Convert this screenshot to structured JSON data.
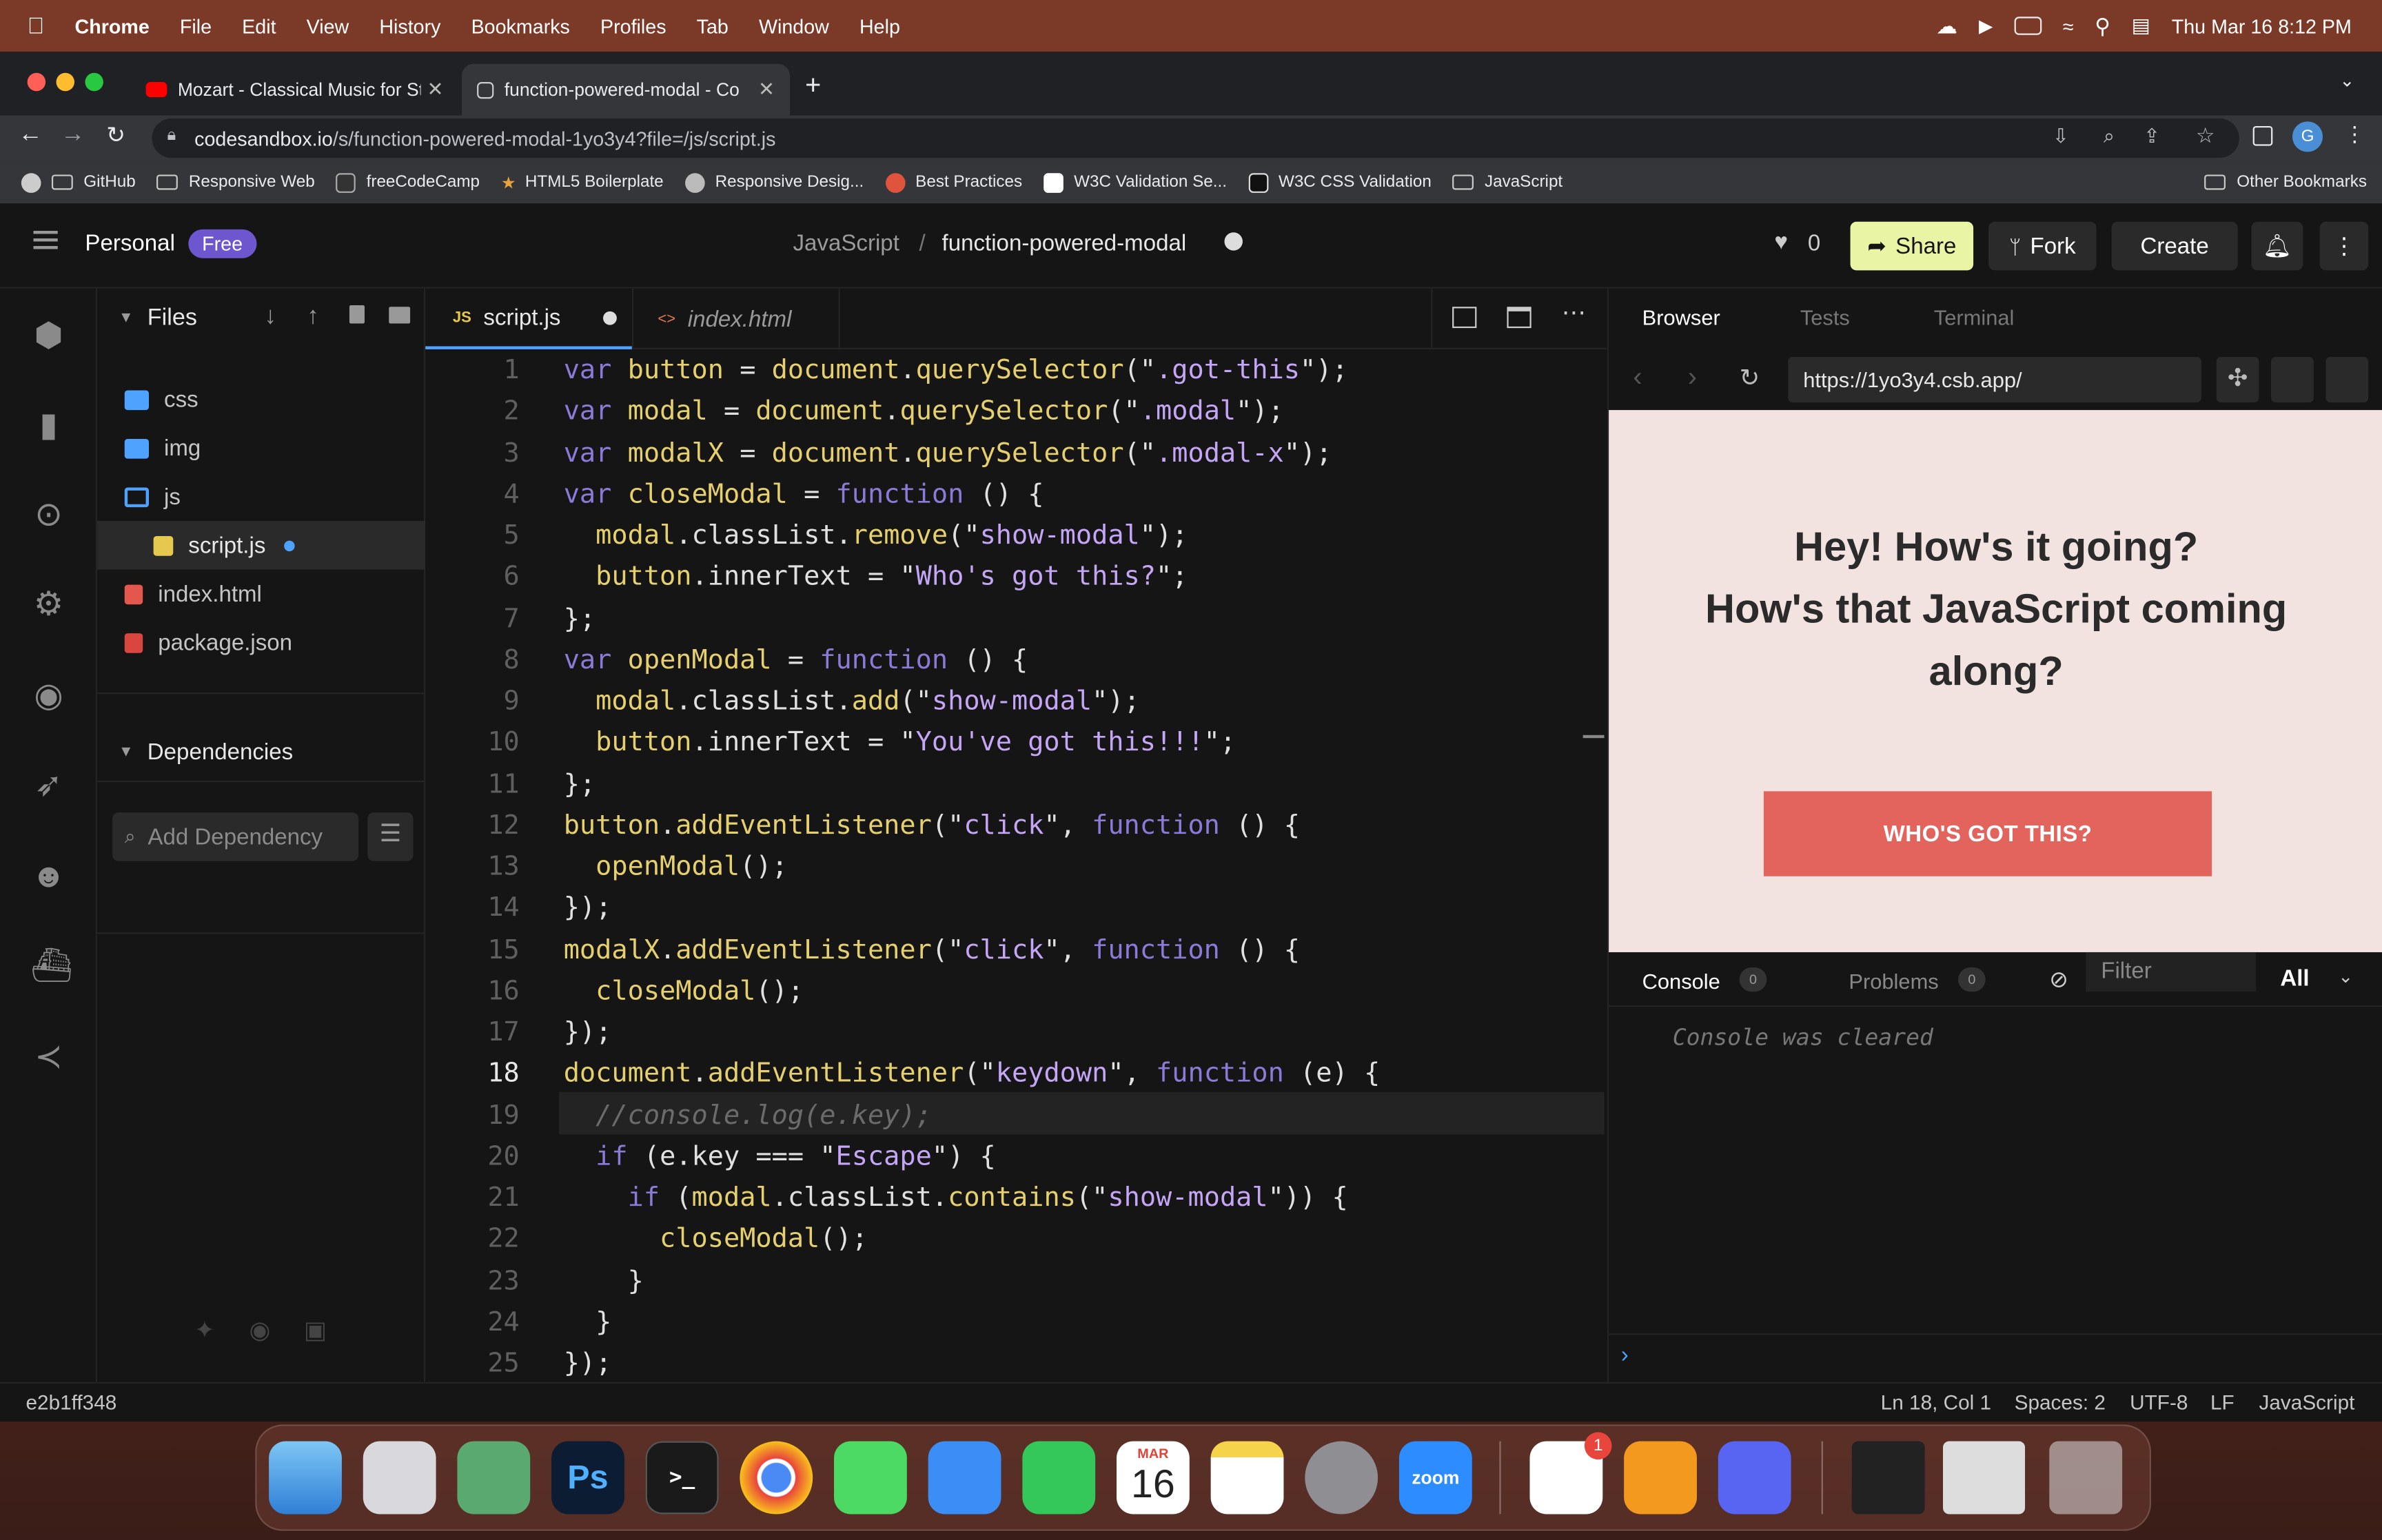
{
  "menubar": {
    "app": "Chrome",
    "items": [
      "File",
      "Edit",
      "View",
      "History",
      "Bookmarks",
      "Profiles",
      "Tab",
      "Window",
      "Help"
    ],
    "clock": "Thu Mar 16  8:12 PM"
  },
  "browser": {
    "tabs": [
      {
        "title": "Mozart - Classical Music for St",
        "active": false
      },
      {
        "title": "function-powered-modal - Co",
        "active": true
      }
    ],
    "url_host": "codesandbox.io",
    "url_path": "/s/function-powered-modal-1yo3y4?file=/js/script.js",
    "bookmarks": [
      "GitHub",
      "Responsive Web",
      "freeCodeCamp",
      "HTML5 Boilerplate",
      "Responsive Desig...",
      "Best Practices",
      "W3C Validation Se...",
      "W3C CSS Validation",
      "JavaScript"
    ],
    "other_bookmarks": "Other Bookmarks",
    "avatar": "G"
  },
  "csb": {
    "workspace": "Personal",
    "plan": "Free",
    "crumb_folder": "JavaScript",
    "crumb_sep": "/",
    "sandbox_name": "function-powered-modal",
    "likes": "0",
    "share": "Share",
    "fork": "Fork",
    "create": "Create",
    "files_title": "Files",
    "files": [
      {
        "name": "css",
        "kind": "folder"
      },
      {
        "name": "img",
        "kind": "folder"
      },
      {
        "name": "js",
        "kind": "folder-open"
      },
      {
        "name": "script.js",
        "kind": "js"
      },
      {
        "name": "index.html",
        "kind": "html"
      },
      {
        "name": "package.json",
        "kind": "pkg"
      }
    ],
    "deps_title": "Dependencies",
    "add_dep": "Add Dependency",
    "editor_tabs": [
      {
        "name": "script.js",
        "badge": "JS"
      },
      {
        "name": "index.html",
        "badge": "<>"
      }
    ],
    "code": [
      "var button = document.querySelector(\".got-this\");",
      "var modal = document.querySelector(\".modal\");",
      "var modalX = document.querySelector(\".modal-x\");",
      "var closeModal = function () {",
      "  modal.classList.remove(\"show-modal\");",
      "  button.innerText = \"Who's got this?\";",
      "};",
      "var openModal = function () {",
      "  modal.classList.add(\"show-modal\");",
      "  button.innerText = \"You've got this!!!\";",
      "};",
      "button.addEventListener(\"click\", function () {",
      "  openModal();",
      "});",
      "modalX.addEventListener(\"click\", function () {",
      "  closeModal();",
      "});",
      "document.addEventListener(\"keydown\", function (e) {",
      "  //console.log(e.key);",
      "  if (e.key === \"Escape\") {",
      "    if (modal.classList.contains(\"show-modal\")) {",
      "      closeModal();",
      "    }",
      "  }",
      "});"
    ],
    "active_line": 18,
    "preview_tabs": [
      "Browser",
      "Tests",
      "Terminal"
    ],
    "preview_url": "https://1yo3y4.csb.app/",
    "preview_heading_1": "Hey! How's it going?",
    "preview_heading_2": "How's that JavaScript coming",
    "preview_heading_3": "along?",
    "preview_button": "WHO'S GOT THIS?",
    "console_tab": "Console",
    "console_count": "0",
    "problems_tab": "Problems",
    "problems_count": "0",
    "filter_placeholder": "Filter",
    "level": "All",
    "console_msg": "Console was cleared",
    "prompt": "›",
    "status": {
      "commit": "e2b1ff348",
      "pos": "Ln 18, Col 1",
      "spaces": "Spaces: 2",
      "enc": "UTF-8",
      "eol": "LF",
      "lang": "JavaScript"
    }
  },
  "dock": {
    "calendar_month": "MAR",
    "calendar_day": "16",
    "ps": "Ps",
    "zoom": "zoom",
    "terminal": ">_",
    "badge": "1"
  },
  "colors": {
    "accent": "#e9f5a5",
    "free_badge": "#6e56cf",
    "modal_bg": "#f2e2e0",
    "modal_button": "#e3645c",
    "heading": "#2b2b2b"
  }
}
